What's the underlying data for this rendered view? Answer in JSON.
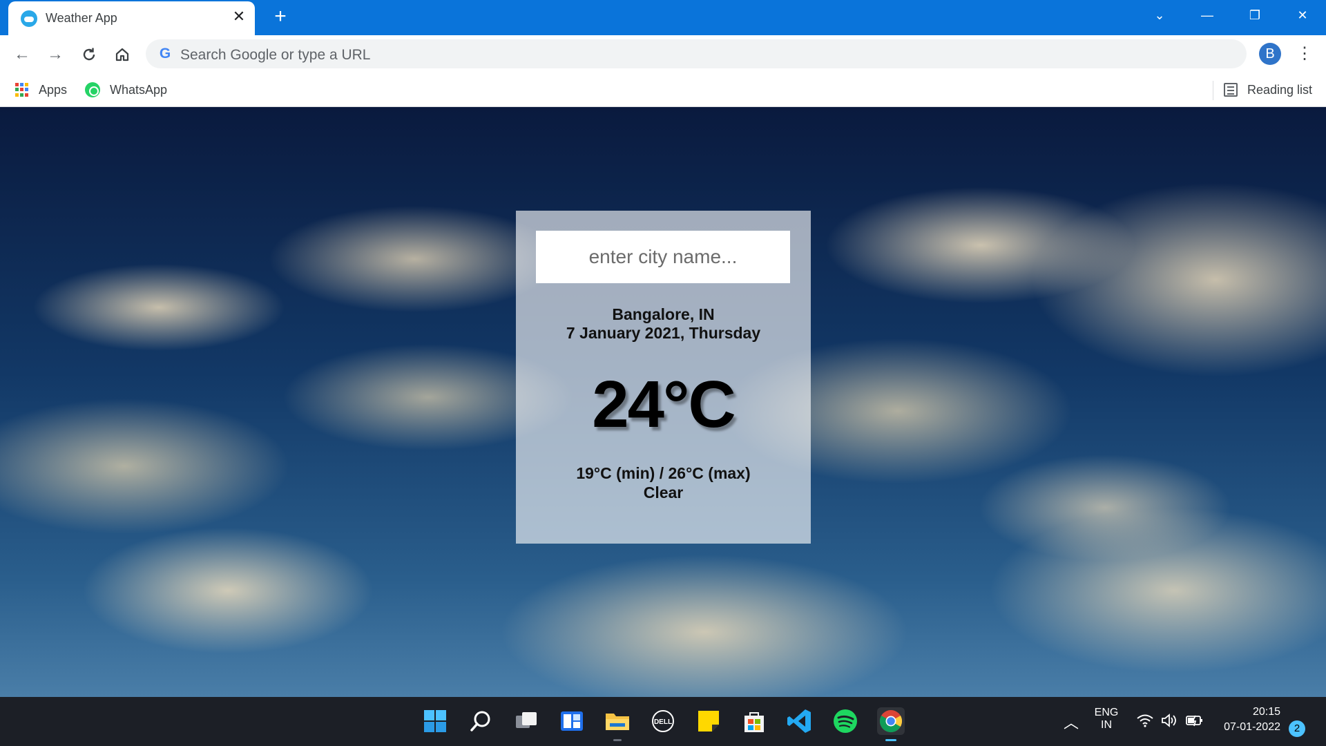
{
  "browser": {
    "tab_title": "Weather App",
    "omnibox_placeholder": "Search Google or type a URL",
    "profile_initial": "B",
    "bookmarks": [
      {
        "label": "Apps",
        "icon": "apps-grid-icon"
      },
      {
        "label": "WhatsApp",
        "icon": "whatsapp-icon"
      }
    ],
    "reading_list_label": "Reading list",
    "accent_color": "#0a74da"
  },
  "weather": {
    "search_placeholder": "enter city name...",
    "location": "Bangalore, IN",
    "date": "7 January 2021, Thursday",
    "temperature": "24°C",
    "min_max": "19°C (min) / 26°C (max)",
    "condition": "Clear"
  },
  "taskbar": {
    "apps": [
      "start-icon",
      "search-icon",
      "task-view-icon",
      "widgets-icon",
      "file-explorer-icon",
      "dell-icon",
      "sticky-notes-icon",
      "microsoft-store-icon",
      "vscode-icon",
      "spotify-icon",
      "chrome-icon"
    ],
    "language_line1": "ENG",
    "language_line2": "IN",
    "time": "20:15",
    "date": "07-01-2022",
    "notification_count": "2"
  }
}
